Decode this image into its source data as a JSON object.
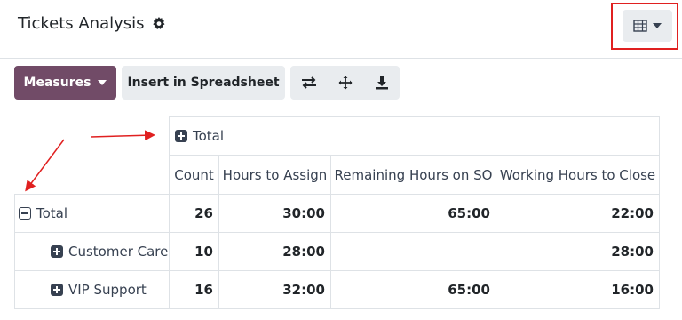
{
  "header": {
    "title": "Tickets Analysis"
  },
  "toolbar": {
    "measures_label": "Measures",
    "insert_label": "Insert in Spreadsheet"
  },
  "pivot": {
    "col_group_label": "Total",
    "measures": [
      "Count",
      "Hours to Assign",
      "Remaining Hours on SO",
      "Working Hours to Close"
    ],
    "rows": [
      {
        "label": "Total",
        "values": [
          "26",
          "30:00",
          "65:00",
          "22:00"
        ]
      },
      {
        "label": "Customer Care",
        "values": [
          "10",
          "28:00",
          "",
          "28:00"
        ]
      },
      {
        "label": "VIP Support",
        "values": [
          "16",
          "32:00",
          "65:00",
          "16:00"
        ]
      }
    ]
  },
  "colors": {
    "primary": "#714b67",
    "annotation": "#e02020"
  }
}
